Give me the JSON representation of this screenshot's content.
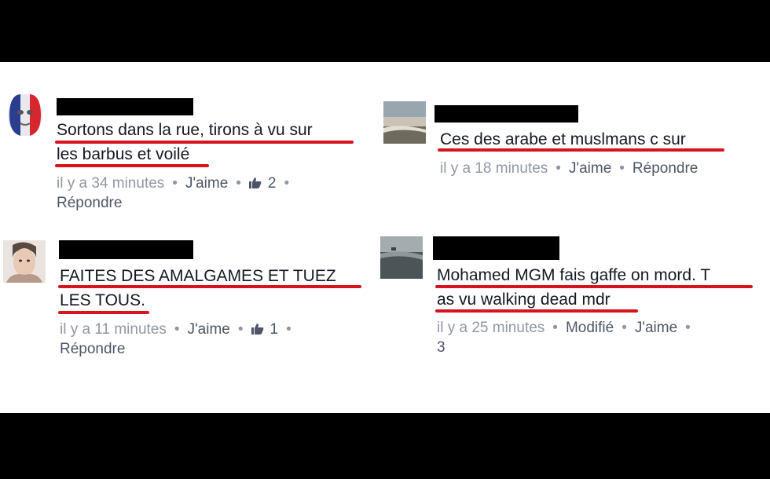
{
  "comments": [
    {
      "text_line1": "Sortons dans la rue, tirons à vu sur",
      "text_line2": "les barbus et voilé",
      "time": "il y a 34 minutes",
      "like": "J'aime",
      "likes_count": "2",
      "reply": "Répondre"
    },
    {
      "text_line1": "Ces des arabe et muslmans c sur",
      "time": "il y a 18 minutes",
      "like": "J'aime",
      "reply": "Répondre"
    },
    {
      "text_line1": "FAITES DES AMALGAMES ET TUEZ",
      "text_line2": "LES TOUS.",
      "time": "il y a 11 minutes",
      "like": "J'aime",
      "likes_count": "1",
      "reply": "Répondre"
    },
    {
      "text_line1": "Mohamed MGM fais gaffe on mord. T",
      "text_line2": "as vu walking dead mdr",
      "time": "il y a 25 minutes",
      "edited": "Modifié",
      "like": "J'aime",
      "likes_count": "3"
    }
  ],
  "icons": {
    "like_thumb": "thumbs-up-icon"
  },
  "colors": {
    "underline": "#d7141e",
    "link": "#4e5665",
    "meta": "#9197a3"
  }
}
